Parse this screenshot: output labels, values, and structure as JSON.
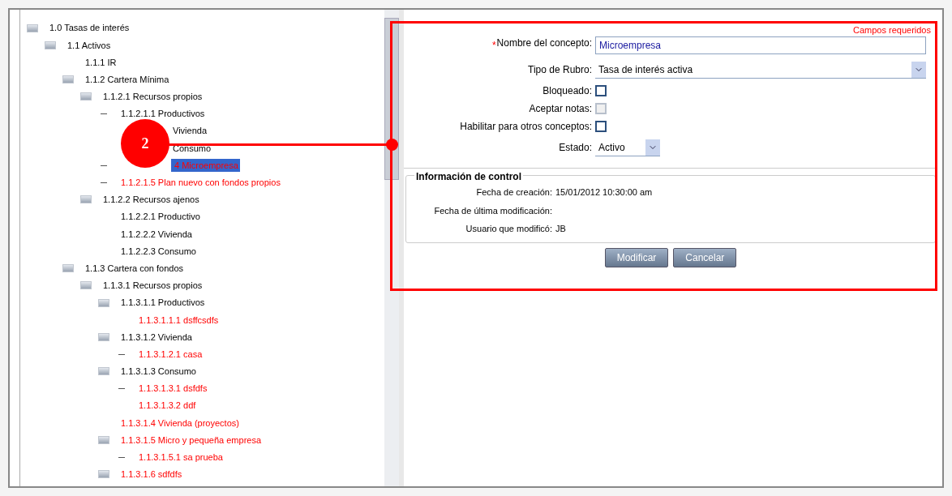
{
  "tree": [
    {
      "label": "1.0 Tasas de interés",
      "kind": "folder",
      "active": true,
      "selected": false,
      "children": [
        {
          "label": "1.1 Activos",
          "kind": "folder",
          "active": true,
          "selected": false,
          "children": [
            {
              "label": "1.1.1 IR",
              "kind": "leaf",
              "active": true,
              "selected": false
            },
            {
              "label": "1.1.2 Cartera Mínima",
              "kind": "folder",
              "active": true,
              "selected": false,
              "children": [
                {
                  "label": "1.1.2.1 Recursos propios",
                  "kind": "folder",
                  "active": true,
                  "selected": false,
                  "children": [
                    {
                      "label": "1.1.2.1.1 Productivos",
                      "kind": "dash",
                      "active": true,
                      "selected": false,
                      "children": [
                        {
                          "label": "Vivienda",
                          "kind": "covered",
                          "active": true,
                          "selected": false
                        },
                        {
                          "label": "Consumo",
                          "kind": "covered",
                          "active": true,
                          "selected": false
                        }
                      ]
                    },
                    {
                      "label": "4 Microempresa",
                      "kind": "dash",
                      "active": false,
                      "selected": true
                    },
                    {
                      "label": "1.1.2.1.5 Plan nuevo con fondos propios",
                      "kind": "dash",
                      "active": false,
                      "selected": false
                    }
                  ]
                },
                {
                  "label": "1.1.2.2 Recursos ajenos",
                  "kind": "folder",
                  "active": true,
                  "selected": false,
                  "children": [
                    {
                      "label": "1.1.2.2.1 Productivo",
                      "kind": "leaf",
                      "active": true,
                      "selected": false
                    },
                    {
                      "label": "1.1.2.2.2 Vivienda",
                      "kind": "leaf",
                      "active": true,
                      "selected": false
                    },
                    {
                      "label": "1.1.2.2.3 Consumo",
                      "kind": "leaf",
                      "active": true,
                      "selected": false
                    }
                  ]
                }
              ]
            },
            {
              "label": "1.1.3 Cartera con fondos",
              "kind": "folder",
              "active": true,
              "selected": false,
              "children": [
                {
                  "label": "1.1.3.1 Recursos propios",
                  "kind": "folder",
                  "active": true,
                  "selected": false,
                  "children": [
                    {
                      "label": "1.1.3.1.1 Productivos",
                      "kind": "folder",
                      "active": true,
                      "selected": false,
                      "children": [
                        {
                          "label": "1.1.3.1.1.1 dsffcsdfs",
                          "kind": "leaf",
                          "active": false,
                          "selected": false
                        }
                      ]
                    },
                    {
                      "label": "1.1.3.1.2 Vivienda",
                      "kind": "folder",
                      "active": true,
                      "selected": false,
                      "children": [
                        {
                          "label": "1.1.3.1.2.1 casa",
                          "kind": "dash",
                          "active": false,
                          "selected": false
                        }
                      ]
                    },
                    {
                      "label": "1.1.3.1.3 Consumo",
                      "kind": "folder",
                      "active": true,
                      "selected": false,
                      "children": [
                        {
                          "label": "1.1.3.1.3.1 dsfdfs",
                          "kind": "dash",
                          "active": false,
                          "selected": false
                        },
                        {
                          "label": "1.1.3.1.3.2 ddf",
                          "kind": "leaf",
                          "active": false,
                          "selected": false
                        }
                      ]
                    },
                    {
                      "label": "1.1.3.1.4 Vivienda (proyectos)",
                      "kind": "leaf",
                      "active": false,
                      "selected": false
                    },
                    {
                      "label": "1.1.3.1.5 Micro y pequeña empresa",
                      "kind": "folder",
                      "active": false,
                      "selected": false,
                      "children": [
                        {
                          "label": "1.1.3.1.5.1 sa prueba",
                          "kind": "dash",
                          "active": false,
                          "selected": false
                        }
                      ]
                    },
                    {
                      "label": "1.1.3.1.6 sdfdfs",
                      "kind": "folder",
                      "active": false,
                      "selected": false
                    }
                  ]
                }
              ]
            }
          ]
        }
      ]
    }
  ],
  "form": {
    "required_note": "Campos requeridos",
    "required_mark": "*",
    "fields": [
      {
        "kind": "text",
        "label": "Nombre del concepto:",
        "required": true,
        "value": "Microempresa"
      },
      {
        "kind": "select",
        "label": "Tipo de Rubro:",
        "required": false,
        "value": "Tasa de interés activa",
        "wide": true
      },
      {
        "kind": "checkbox",
        "label": "Bloqueado:",
        "required": false,
        "checked": false,
        "disabled": false
      },
      {
        "kind": "checkbox",
        "label": "Aceptar notas:",
        "required": false,
        "checked": false,
        "disabled": true
      },
      {
        "kind": "checkbox",
        "label": "Habilitar para otros conceptos:",
        "required": false,
        "checked": false,
        "disabled": false
      },
      {
        "kind": "select",
        "label": "Estado:",
        "required": false,
        "value": "Activo",
        "wide": false
      }
    ],
    "control_info": {
      "title": "Información de control",
      "rows": [
        {
          "label": "Fecha de creación:",
          "value": "15/01/2012 10:30:00 am"
        },
        {
          "label": "Fecha de última modificación:"
        },
        {
          "label": "Usuario que modificó:",
          "value": "JB"
        }
      ]
    },
    "buttons": [
      "Modificar",
      "Cancelar"
    ]
  },
  "callout": {
    "number": "2"
  }
}
